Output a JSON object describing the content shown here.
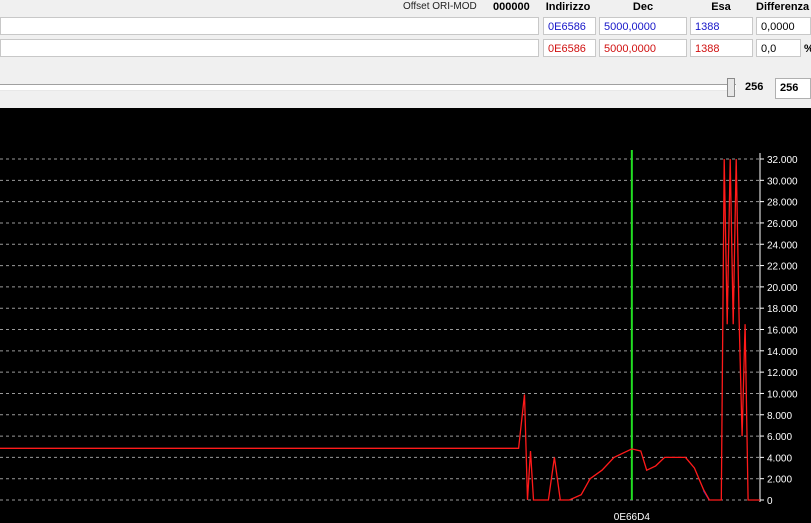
{
  "header": {
    "offset_label": "Offset ORI-MOD",
    "offset_value": "000000",
    "col_address": "Indirizzo",
    "col_dec": "Dec",
    "col_hex": "Esa",
    "col_diff": "Differenza"
  },
  "rows": [
    {
      "address": "0E6586",
      "dec": "5000,0000",
      "hex": "1388",
      "diff": "0,0000",
      "color": "#1515c8"
    },
    {
      "address": "0E6586",
      "dec": "5000,0000",
      "hex": "1388",
      "diff": "0,0",
      "color": "#d01010",
      "suffix": "%"
    }
  ],
  "zoom": {
    "label": "256",
    "value": "256"
  },
  "colors": {
    "background": "#000000",
    "grid": "#9a9a9a",
    "series": "#ff1a1a",
    "cursor": "#22dd22",
    "reference": "#2828c8"
  },
  "chart_data": {
    "type": "line",
    "ylim": [
      0,
      32000
    ],
    "ytick_labels": [
      "0",
      "2.000",
      "4.000",
      "6.000",
      "8.000",
      "10.000",
      "12.000",
      "14.000",
      "16.000",
      "18.000",
      "20.000",
      "22.000",
      "24.000",
      "26.000",
      "28.000",
      "30.000",
      "32.000"
    ],
    "ytick_values": [
      0,
      2000,
      4000,
      6000,
      8000,
      10000,
      12000,
      14000,
      16000,
      18000,
      20000,
      22000,
      24000,
      26000,
      28000,
      30000,
      32000
    ],
    "cursor_label": "0E66D4",
    "cursor_index": 212,
    "grid": true,
    "points_count": 256,
    "series": [
      {
        "color": "#ff1a1a",
        "points": [
          [
            0,
            4850
          ],
          [
            174,
            4850
          ],
          [
            176,
            9900
          ],
          [
            177,
            0
          ],
          [
            178,
            4600
          ],
          [
            179,
            0
          ],
          [
            184,
            0
          ],
          [
            186,
            4000
          ],
          [
            188,
            0
          ],
          [
            191,
            0
          ],
          [
            195,
            500
          ],
          [
            198,
            2000
          ],
          [
            202,
            2800
          ],
          [
            206,
            4000
          ],
          [
            212,
            4800
          ],
          [
            215,
            4600
          ],
          [
            217,
            2800
          ],
          [
            220,
            3200
          ],
          [
            223,
            4000
          ],
          [
            230,
            4000
          ],
          [
            233,
            3000
          ],
          [
            236,
            1000
          ],
          [
            238,
            0
          ],
          [
            242,
            0
          ],
          [
            243,
            33000
          ],
          [
            244,
            16500
          ],
          [
            245,
            33000
          ],
          [
            246,
            16500
          ],
          [
            247,
            33000
          ],
          [
            248,
            17000
          ],
          [
            249,
            6000
          ],
          [
            250,
            16500
          ],
          [
            251,
            0
          ],
          [
            255,
            0
          ]
        ]
      }
    ]
  }
}
